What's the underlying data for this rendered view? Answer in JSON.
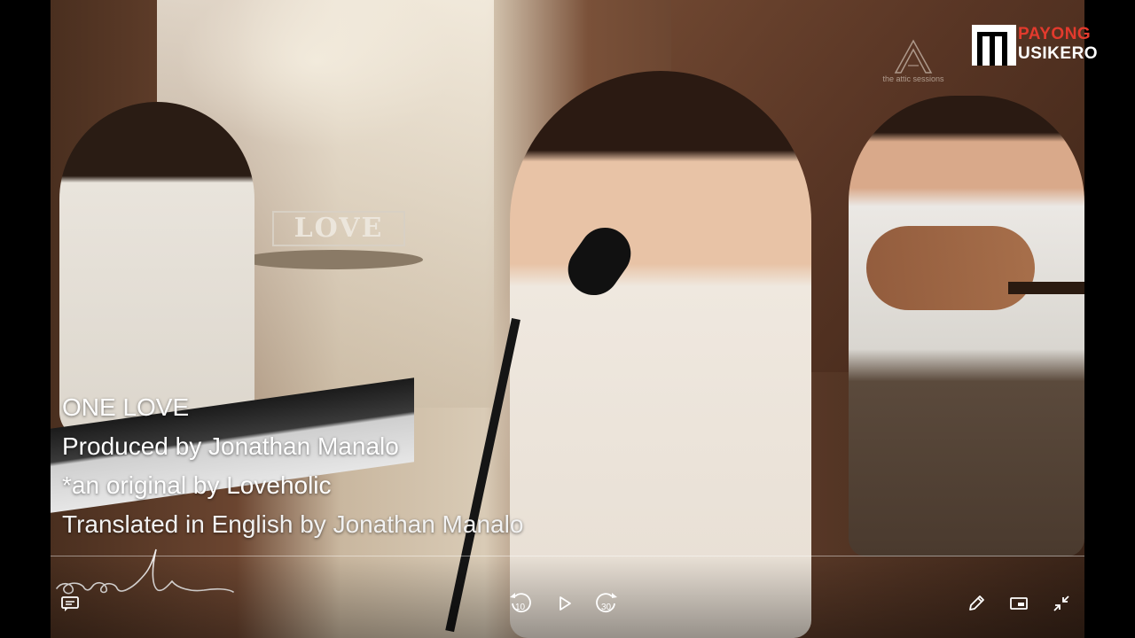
{
  "video": {
    "caption": {
      "line1": "ONE LOVE",
      "line2": "Produced by Jonathan Manalo",
      "line3": "*an original by Loveholic",
      "line4": "Translated in English by Jonathan Manalo"
    },
    "scene_sign_text": "LOVE",
    "brand": {
      "word_top": "PAYONG",
      "word_bottom": "USIKERO",
      "accent_color": "#e33a2d"
    },
    "attic_logo_tag": "the attic sessions",
    "signature_text": "aceli"
  },
  "controls": {
    "rewind_seconds": "10",
    "forward_seconds": "30",
    "icons": {
      "subtitles": "subtitles-icon",
      "rewind": "rewind-10-icon",
      "play": "play-icon",
      "forward": "forward-30-icon",
      "edit": "pencil-icon",
      "miniplayer": "miniplayer-icon",
      "exit_fullscreen": "exit-fullscreen-icon"
    }
  }
}
